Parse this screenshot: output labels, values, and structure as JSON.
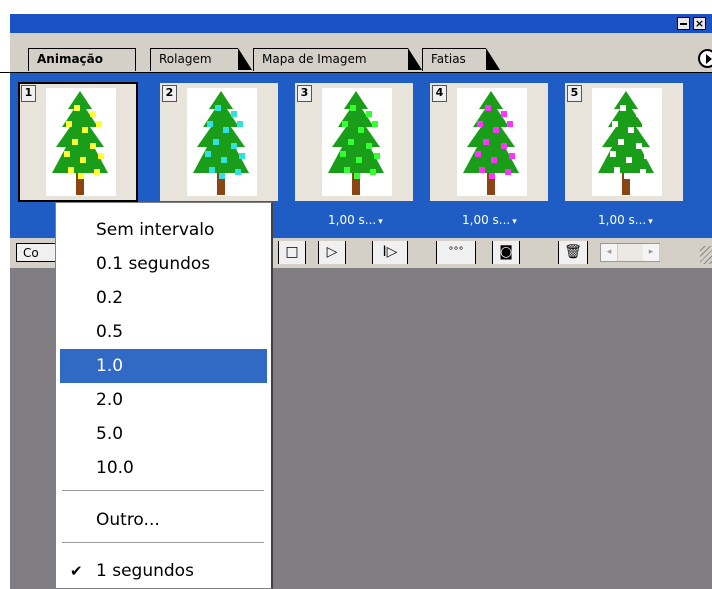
{
  "tabs": [
    "Animação",
    "Rolagem",
    "Mapa de Imagem",
    "Fatias"
  ],
  "frames": [
    {
      "number": "1",
      "light_color": "#ffff33",
      "delay": ""
    },
    {
      "number": "2",
      "light_color": "#33e0e0",
      "delay": ""
    },
    {
      "number": "3",
      "light_color": "#33ff33",
      "delay": "1,00 s..."
    },
    {
      "number": "4",
      "light_color": "#ff33ff",
      "delay": "1,00 s..."
    },
    {
      "number": "5",
      "light_color": "#ffffff",
      "delay": "1,00 s..."
    }
  ],
  "controls": {
    "loop_label": "Co",
    "buttons": [
      {
        "icon": "stop-icon",
        "glyph": "□"
      },
      {
        "icon": "play-icon",
        "glyph": "▷"
      },
      {
        "icon": "next-frame-icon",
        "glyph": "I▷"
      },
      {
        "icon": "tween-icon",
        "glyph": "°°°"
      },
      {
        "icon": "duplicate-frame-icon",
        "glyph": "◙"
      },
      {
        "icon": "trash-icon",
        "glyph": "🗑"
      }
    ]
  },
  "delay_menu": {
    "items": [
      "Sem intervalo",
      "0.1 segundos",
      "0.2",
      "0.5",
      "1.0",
      "2.0",
      "5.0",
      "10.0"
    ],
    "selected": "1.0",
    "other": "Outro...",
    "current": "1 segundos",
    "check": "✔"
  },
  "colors": {
    "titlebar": "#1a52c4",
    "frames_bg": "#1f5cc4",
    "selection": "#316ac5",
    "tree": "#1a9e1a",
    "trunk": "#8b4513"
  }
}
